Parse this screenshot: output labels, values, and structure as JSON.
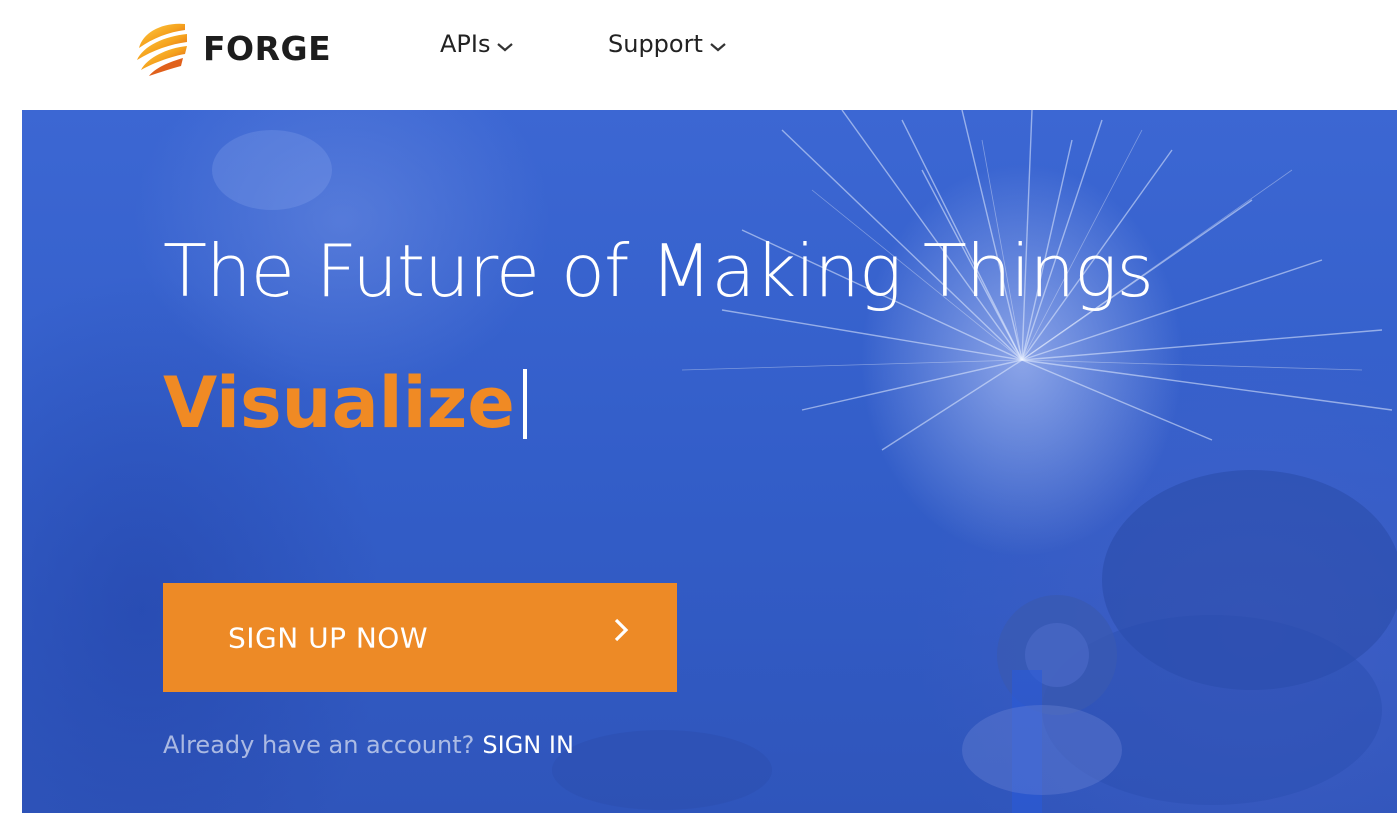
{
  "header": {
    "brand_name": "FORGE",
    "nav": [
      {
        "label": "APIs",
        "icon": "chevron-down-icon"
      },
      {
        "label": "Support",
        "icon": "chevron-down-icon"
      }
    ]
  },
  "hero": {
    "title": "The Future of Making Things",
    "rotating_word": "Visualize",
    "signup_label": "SIGN UP NOW",
    "signup_icon": "chevron-right-icon",
    "signin_prompt": "Already have an account?",
    "signin_link": "SIGN IN"
  },
  "colors": {
    "accent_orange": "#ed8a26",
    "hero_blue": "#3560cc",
    "text_dark": "#1d1d1d",
    "white": "#ffffff"
  }
}
